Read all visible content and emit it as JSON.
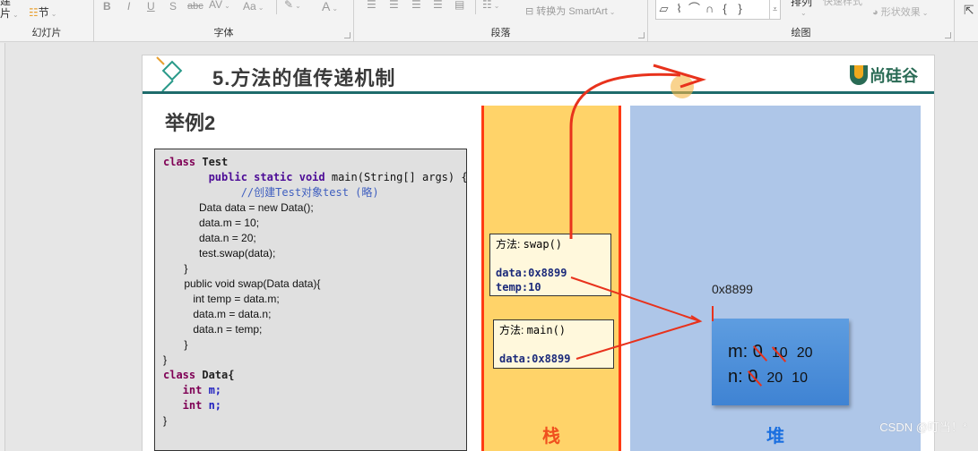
{
  "ribbon": {
    "groups": [
      {
        "label": "幻灯片",
        "items": [
          "建",
          "片",
          "节"
        ]
      },
      {
        "label": "字体",
        "items": [
          "B",
          "I",
          "U",
          "S",
          "abc",
          "AV",
          "Aa",
          "A"
        ]
      },
      {
        "label": "段落",
        "items": [
          "align-left",
          "align-center",
          "align-right",
          "justify",
          "columns",
          "转换为 SmartArt"
        ]
      },
      {
        "label": "绘图",
        "items": [
          "排列",
          "快速样式",
          "形状效果"
        ]
      }
    ],
    "slide_new_label": "建",
    "slide_label": "片",
    "section_label": "节",
    "font_buttons": {
      "bold": "B",
      "italic": "I",
      "underline": "U",
      "shadow": "S",
      "strike": "abc",
      "spacing": "AV",
      "case": "Aa",
      "color": "A"
    },
    "smartart_label": "转换为 SmartArt",
    "arrange_label": "排列",
    "quick_styles_label": "快速样式",
    "shape_effects_label": "形状效果",
    "shape_gallery": [
      "▱",
      "⌇",
      "⌒",
      "∩",
      "{",
      "}"
    ]
  },
  "slide": {
    "title": "5.方法的值传递机制",
    "logo_text": "尚硅谷",
    "subtitle": "举例2",
    "code": [
      {
        "parts": [
          {
            "t": "class ",
            "c": "kw"
          },
          {
            "t": "Test",
            "c": "cls"
          }
        ]
      },
      {
        "parts": [
          {
            "t": "       public static void ",
            "c": "kw2"
          },
          {
            "t": "main(String[] args) {",
            "c": "mono"
          }
        ]
      },
      {
        "parts": [
          {
            "t": "            //创建Test对象test (略)",
            "c": "cmt"
          }
        ]
      },
      {
        "parts": [
          {
            "t": "            Data data = new Data();",
            "c": ""
          }
        ]
      },
      {
        "parts": [
          {
            "t": "            data.m = 10;",
            "c": ""
          }
        ]
      },
      {
        "parts": [
          {
            "t": "            data.n = 20;",
            "c": ""
          }
        ]
      },
      {
        "parts": [
          {
            "t": "            test.swap(data);",
            "c": ""
          }
        ]
      },
      {
        "parts": [
          {
            "t": "       }",
            "c": ""
          }
        ]
      },
      {
        "parts": [
          {
            "t": "       public void swap(Data data){",
            "c": ""
          }
        ]
      },
      {
        "parts": [
          {
            "t": "          int temp = data.m;",
            "c": ""
          }
        ]
      },
      {
        "parts": [
          {
            "t": "          data.m = data.n;",
            "c": ""
          }
        ]
      },
      {
        "parts": [
          {
            "t": "          data.n = temp;",
            "c": ""
          }
        ]
      },
      {
        "parts": [
          {
            "t": "       }",
            "c": ""
          }
        ]
      },
      {
        "parts": [
          {
            "t": "}",
            "c": ""
          }
        ]
      },
      {
        "parts": [
          {
            "t": "class ",
            "c": "kw"
          },
          {
            "t": "Data{",
            "c": "cls"
          }
        ]
      },
      {
        "parts": [
          {
            "t": "   int ",
            "c": "kw"
          },
          {
            "t": "m;",
            "c": "fld"
          }
        ]
      },
      {
        "parts": [
          {
            "t": "   int ",
            "c": "kw"
          },
          {
            "t": "n;",
            "c": "fld"
          }
        ]
      },
      {
        "parts": [
          {
            "t": "}",
            "c": ""
          }
        ]
      }
    ],
    "stack": {
      "label": "栈",
      "frames": [
        {
          "method_label": "方法: ",
          "method": "swap()",
          "vars": [
            "data:0x8899",
            "temp:10"
          ]
        },
        {
          "method_label": "方法: ",
          "method": "main()",
          "vars": [
            "data:0x8899"
          ]
        }
      ]
    },
    "heap": {
      "label": "堆",
      "address": "0x8899",
      "object": {
        "m_label": "m: ",
        "m_values": [
          {
            "v": "0",
            "struck": true
          },
          {
            "v": "10",
            "struck": true
          },
          {
            "v": "20",
            "struck": false
          }
        ],
        "n_label": "n: ",
        "n_values": [
          {
            "v": "0",
            "struck": true
          },
          {
            "v": "20",
            "struck": false
          },
          {
            "v": "10",
            "struck": false
          }
        ]
      }
    },
    "annotation_color": "#e8321c"
  },
  "watermark": "CSDN @叮当！*",
  "colors": {
    "title_line": "#1e6b6b",
    "stack_bg": "#ffd369",
    "stack_border": "#ff3b14",
    "heap_bg": "#aec6e8",
    "object_bg": "#4a8fd8",
    "stack_label": "#f0501e",
    "heap_label": "#1a6fe0"
  }
}
